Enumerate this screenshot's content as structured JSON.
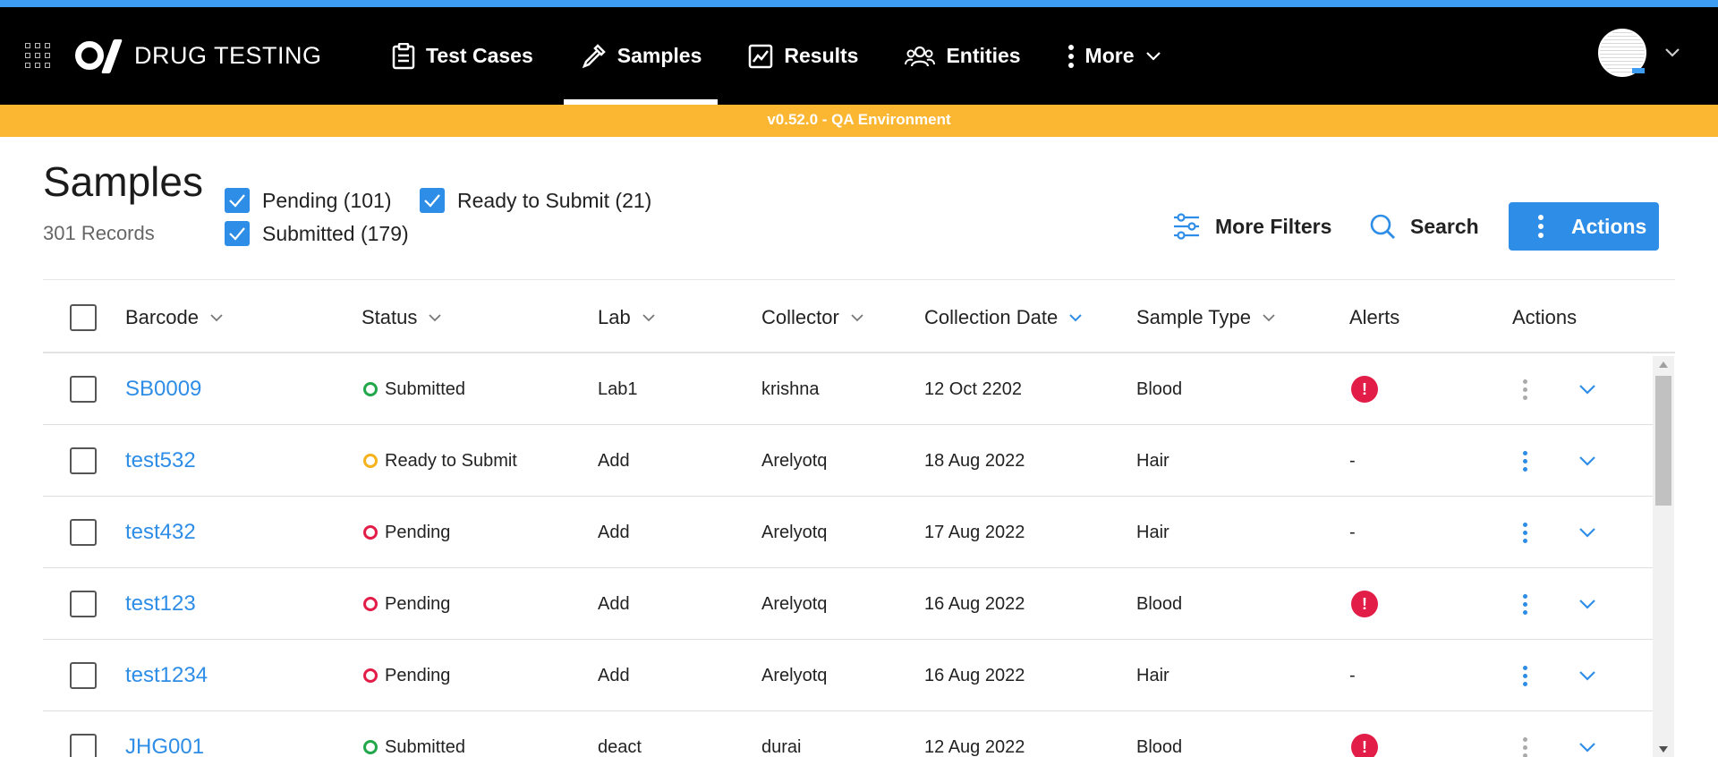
{
  "app": {
    "name": "DRUG TESTING",
    "environment_banner": "v0.52.0 - QA Environment"
  },
  "nav": {
    "items": [
      {
        "label": "Test Cases",
        "icon": "clipboard-icon",
        "active": false
      },
      {
        "label": "Samples",
        "icon": "pipette-icon",
        "active": true
      },
      {
        "label": "Results",
        "icon": "chart-icon",
        "active": false
      },
      {
        "label": "Entities",
        "icon": "people-icon",
        "active": false
      },
      {
        "label": "More",
        "icon": "kebab-icon",
        "active": false
      }
    ]
  },
  "page": {
    "title": "Samples",
    "record_count": "301 Records"
  },
  "filters": {
    "pending": "Pending (101)",
    "ready": "Ready to Submit (21)",
    "submitted": "Submitted (179)"
  },
  "toolbar": {
    "more_filters": "More Filters",
    "search": "Search",
    "actions": "Actions"
  },
  "table": {
    "columns": {
      "barcode": "Barcode",
      "status": "Status",
      "lab": "Lab",
      "collector": "Collector",
      "collection_date": "Collection Date",
      "sample_type": "Sample Type",
      "alerts": "Alerts",
      "actions": "Actions"
    },
    "rows": [
      {
        "barcode": "SB0009",
        "status": "Submitted",
        "lab": "Lab1",
        "collector": "krishna",
        "date": "12 Oct 2202",
        "type": "Blood",
        "alert": true,
        "alert_text": "",
        "actions_enabled": false
      },
      {
        "barcode": "test532",
        "status": "Ready to Submit",
        "lab": "Add",
        "collector": "Arelyotq",
        "date": "18 Aug 2022",
        "type": "Hair",
        "alert": false,
        "alert_text": "-",
        "actions_enabled": true
      },
      {
        "barcode": "test432",
        "status": "Pending",
        "lab": "Add",
        "collector": "Arelyotq",
        "date": "17 Aug 2022",
        "type": "Hair",
        "alert": false,
        "alert_text": "-",
        "actions_enabled": true
      },
      {
        "barcode": "test123",
        "status": "Pending",
        "lab": "Add",
        "collector": "Arelyotq",
        "date": "16 Aug 2022",
        "type": "Blood",
        "alert": true,
        "alert_text": "",
        "actions_enabled": true
      },
      {
        "barcode": "test1234",
        "status": "Pending",
        "lab": "Add",
        "collector": "Arelyotq",
        "date": "16 Aug 2022",
        "type": "Hair",
        "alert": false,
        "alert_text": "-",
        "actions_enabled": true
      },
      {
        "barcode": "JHG001",
        "status": "Submitted",
        "lab": "deact",
        "collector": "durai",
        "date": "12 Aug 2022",
        "type": "Blood",
        "alert": true,
        "alert_text": "",
        "actions_enabled": false
      }
    ]
  },
  "colors": {
    "accent": "#2e8de6",
    "env_banner": "#fbb632",
    "status_submitted": "#22a84a",
    "status_ready": "#f5b21c",
    "status_pending": "#e11d48",
    "alert": "#e11d48"
  }
}
